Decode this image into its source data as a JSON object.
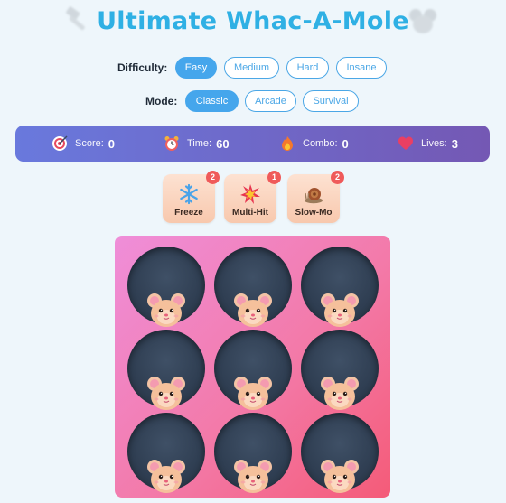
{
  "title": "Ultimate Whac-A-Mole",
  "difficulty": {
    "label": "Difficulty:",
    "options": [
      "Easy",
      "Medium",
      "Hard",
      "Insane"
    ],
    "selected": "Easy"
  },
  "mode": {
    "label": "Mode:",
    "options": [
      "Classic",
      "Arcade",
      "Survival"
    ],
    "selected": "Classic"
  },
  "stats": {
    "score": {
      "label": "Score:",
      "value": "0",
      "icon": "target-icon"
    },
    "time": {
      "label": "Time:",
      "value": "60",
      "icon": "alarm-clock-icon"
    },
    "combo": {
      "label": "Combo:",
      "value": "0",
      "icon": "fire-icon"
    },
    "lives": {
      "label": "Lives:",
      "value": "3",
      "icon": "heart-icon"
    }
  },
  "powerups": [
    {
      "label": "Freeze",
      "count": "2",
      "icon": "snowflake-icon"
    },
    {
      "label": "Multi-Hit",
      "count": "1",
      "icon": "explosion-icon"
    },
    {
      "label": "Slow-Mo",
      "count": "2",
      "icon": "snail-icon"
    }
  ],
  "board": {
    "rows": 3,
    "cols": 3,
    "holes": [
      "mouse",
      "mouse",
      "mouse",
      "mouse",
      "mouse",
      "mouse",
      "mouse",
      "mouse",
      "mouse"
    ]
  },
  "colors": {
    "title": "#2fb0e4",
    "accent": "#45a6ec",
    "stats_bar_start": "#6979dd",
    "stats_bar_end": "#7458b4",
    "board_start": "#ef8ed9",
    "board_end": "#f45b78",
    "badge": "#ef5a5a"
  }
}
